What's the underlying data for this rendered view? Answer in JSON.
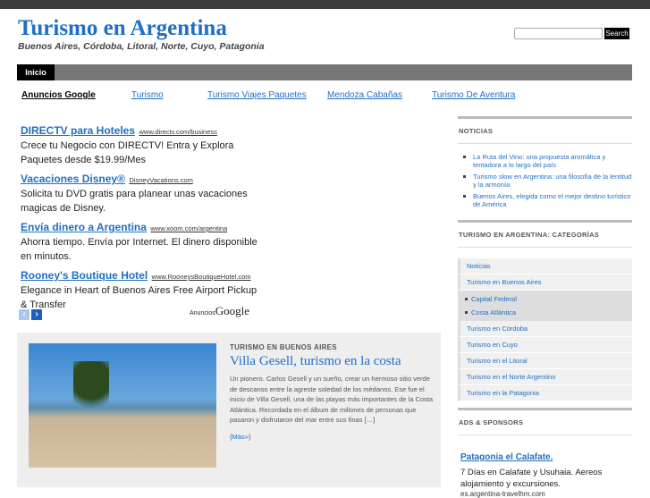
{
  "header": {
    "title": "Turismo en Argentina",
    "tagline": "Buenos Aires, Córdoba, Litoral, Norte, Cuyo, Patagonia",
    "search_button": "Search",
    "search_value": ""
  },
  "nav": {
    "tabs": [
      {
        "label": "Inicio"
      }
    ]
  },
  "link_units": {
    "heading": "Anuncios Google",
    "links": [
      "Turismo",
      "Turismo Viajes Paquetes",
      "Mendoza Cabañas",
      "Turismo De Aventura"
    ]
  },
  "ads": {
    "items": [
      {
        "title": "DIRECTV para Hoteles",
        "url": "www.directv.com/business",
        "desc": "Crece tu Negocio con DIRECTV! Entra y Explora Paquetes desde $19.99/Mes"
      },
      {
        "title": "Vacaciones Disney®",
        "url": "DisneyVacations.com",
        "desc": "Solicita tu DVD gratis para planear unas vacaciones magicas de Disney."
      },
      {
        "title": "Envía dinero a Argentina",
        "url": "www.xoom.com/argentina",
        "desc": "Ahorra tiempo. Envía por Internet. El dinero disponible en minutos."
      },
      {
        "title": "Rooney's Boutique Hotel",
        "url": "www.RooneysBoutiqueHotel.com",
        "desc": "Elegance in Heart of Buenos Aires Free Airport Pickup & Transfer"
      }
    ],
    "prev": "‹",
    "next": "›",
    "by_label": "Anuncios",
    "by_brand": "Google"
  },
  "post": {
    "category": "TURISMO EN BUENOS AIRES",
    "title": "Villa Gesell, turismo en la costa",
    "excerpt": "Un pionero. Carlos Gesell y un sueño, crear un hermoso sitio verde de descanso entre la agreste soledad de los médanos. Ese fue el inicio de Villa Gesell, una de las playas más importantes de la Costa Atlántica. Recordada en el álbum de millones de personas que pasaron y disfrutaron del mar entre sus finas […]",
    "more_open": "{",
    "more": "Más»",
    "more_close": "}"
  },
  "sidebar": {
    "news": {
      "heading": "NOTICIAS",
      "items": [
        "La Ruta del Vino: una propuesta aromática y tentadora a lo largo del país",
        "Turismo slow en Argentina: una filosofía de la lentitud y la armonía",
        "Buenos Aires, elegida como el mejor destino turístico de América"
      ]
    },
    "categories": {
      "heading": "TURISMO EN ARGENTINA: CATEGORÍAS",
      "items": [
        "Noticias",
        "Turismo en Buenos Aires",
        "Turismo en Córdoba",
        "Turismo en Cuyo",
        "Turismo en el Litoral",
        "Turismo en el Norte Argentino",
        "Turismo en la Patagonia"
      ],
      "sub": [
        "Capital Federal",
        "Costa Atlántica"
      ]
    },
    "sponsors": {
      "heading": "ADS & SPONSORS",
      "title": "Patagonia el Calafate.",
      "desc": "7 Días en Calafate y Usuhaia. Aereos alojamiento y excursiones.",
      "url": "es.argentina-travelhm.com"
    }
  }
}
